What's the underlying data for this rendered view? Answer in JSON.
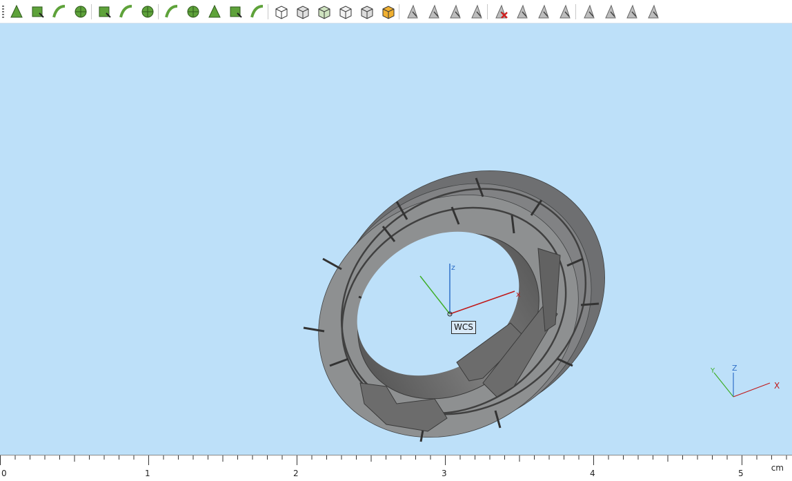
{
  "toolbar": {
    "groups": [
      [
        "select-vertex",
        "select-face",
        "select-edge-arrow",
        "select-circle"
      ],
      [
        "sketch-rect",
        "sketch-chain",
        "sketch-curve"
      ],
      [
        "select-surface",
        "select-blob",
        "select-pattern",
        "select-wheel",
        "select-cut-wheel"
      ],
      [
        "select-box",
        "select-box-shaded",
        "select-box-color",
        "select-box-wire",
        "select-box-point",
        "select-box-solid"
      ],
      [
        "pick-arrow",
        "pick-edge-arrow",
        "pick-face-arrow",
        "pick-sweep"
      ],
      [
        "delete-pick",
        "pick-gray-1",
        "pick-gray-2",
        "pick-gray-3"
      ],
      [
        "view-1",
        "view-2",
        "view-3",
        "view-4"
      ]
    ]
  },
  "viewport": {
    "background": "#bde0f9",
    "wcs_label": "WCS",
    "axis_labels": {
      "x": "x",
      "z": "z"
    },
    "triad_labels": {
      "x": "X",
      "y": "Y",
      "z": "Z"
    }
  },
  "ruler": {
    "labels": [
      "0",
      "1",
      "2",
      "3",
      "4",
      "5"
    ],
    "unit": "cm"
  },
  "colors": {
    "x_axis": "#c01818",
    "y_axis": "#3fae2a",
    "z_axis": "#2f6fc8",
    "model": "#7c7c7c",
    "icon_green": "#5ea23a"
  }
}
